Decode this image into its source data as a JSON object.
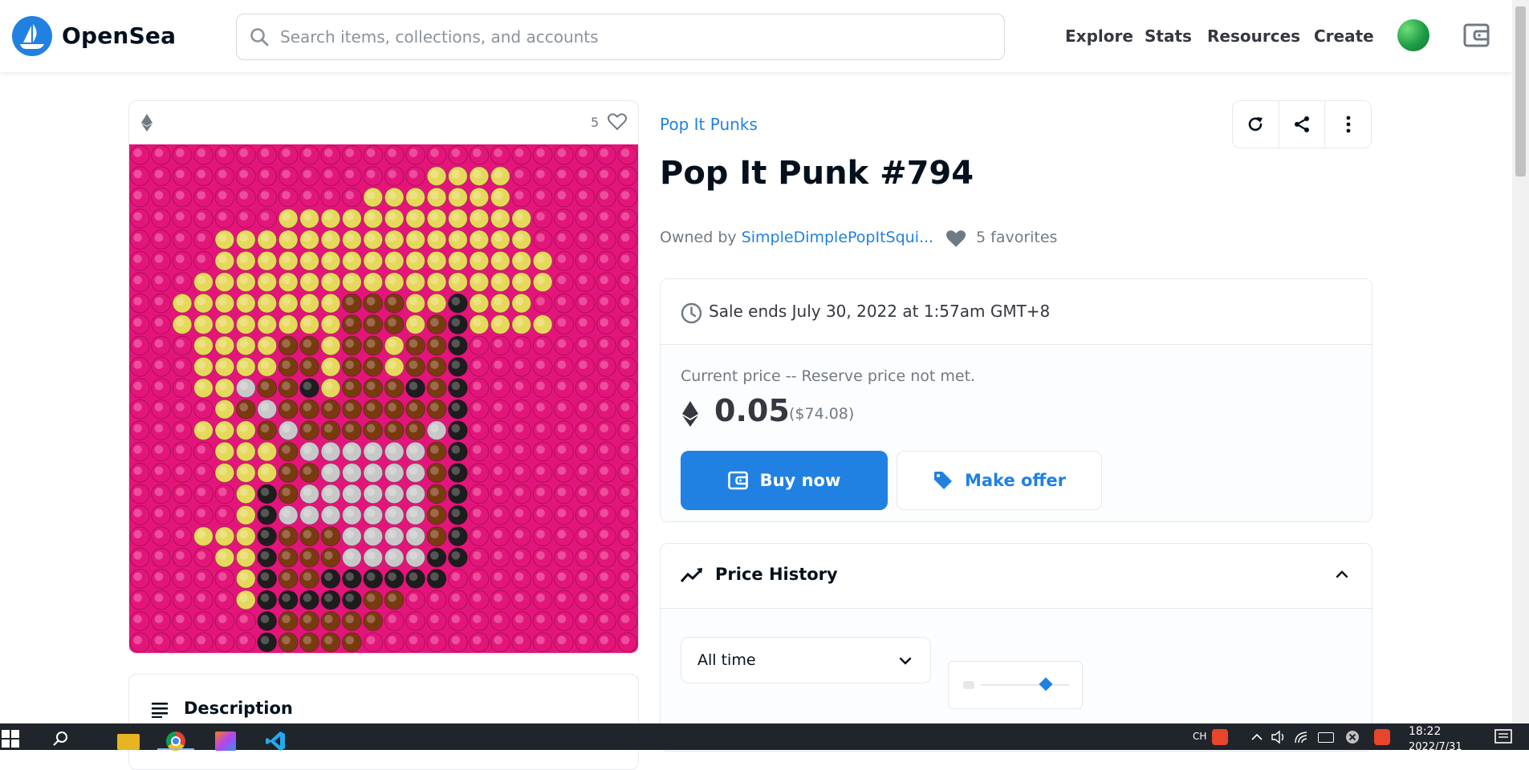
{
  "header": {
    "brand": "OpenSea",
    "search_placeholder": "Search items, collections, and accounts",
    "nav": [
      "Explore",
      "Stats",
      "Resources",
      "Create"
    ]
  },
  "item": {
    "favorite_count": "5",
    "collection": "Pop It Punks",
    "title": "Pop It Punk #794",
    "owned_by_label": "Owned by",
    "owner": "SimpleDimplePopItSqui...",
    "favorites": "5 favorites"
  },
  "sale": {
    "ends": "Sale ends July 30, 2022 at 1:57am GMT+8",
    "current_price_label": "Current price -- Reserve price not met.",
    "price": "0.05",
    "price_usd": "($74.08)",
    "buy_label": "Buy now",
    "offer_label": "Make offer"
  },
  "price_history": {
    "title": "Price History",
    "range": "All time"
  },
  "description": {
    "title": "Description"
  },
  "taskbar": {
    "time": "18:22",
    "date": "2022/7/31",
    "ime": "CH"
  },
  "colors": {
    "accent": "#2081e2",
    "nft_background": "#e4157a",
    "nft_yellow": "#e6d85a",
    "nft_brown": "#7a3a10",
    "nft_black": "#1d1d1d",
    "nft_gray": "#c8c8c8"
  },
  "icons": [
    "search-icon",
    "wallet-icon",
    "ethereum-icon",
    "heart-icon",
    "refresh-icon",
    "share-icon",
    "more-icon",
    "clock-icon",
    "tag-icon",
    "chart-line-icon",
    "chevron-up-icon",
    "chevron-down-icon",
    "menu-lines-icon"
  ]
}
